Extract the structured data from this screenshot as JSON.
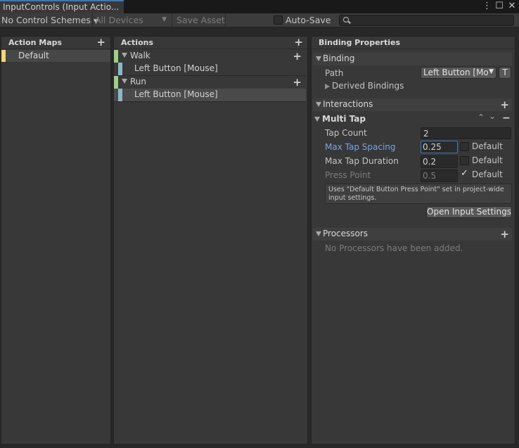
{
  "window": {
    "tab_title": "InputControls (Input Actio...",
    "menu_icon": "vertical-dots-icon",
    "maximize_icon": "maximize-icon",
    "close_icon": "close-icon",
    "menu_glyph": "⋮",
    "maximize_glyph": "☐",
    "close_glyph": "✕"
  },
  "toolbar": {
    "control_schemes": "No Control Schemes",
    "devices": "All Devices",
    "save_asset": "Save Asset",
    "auto_save": "Auto-Save",
    "auto_save_checked": false,
    "search_value": "",
    "dropdown_glyph": "▼"
  },
  "action_maps": {
    "header": "Action Maps",
    "add_glyph": "+",
    "items": [
      {
        "label": "Default",
        "color": "#f3d579",
        "selected": true
      }
    ]
  },
  "actions": {
    "header": "Actions",
    "add_glyph": "+",
    "rows": [
      {
        "kind": "action",
        "label": "Walk",
        "color": "#9fcf86"
      },
      {
        "kind": "binding",
        "label": "Left Button [Mouse]",
        "color": "#8ab8c9"
      },
      {
        "kind": "action",
        "label": "Run",
        "color": "#9fcf86"
      },
      {
        "kind": "binding",
        "label": "Left Button [Mouse]",
        "color": "#8ab8c9",
        "selected": true
      }
    ]
  },
  "binding_properties": {
    "header": "Binding Properties",
    "binding_section": "Binding",
    "path_label": "Path",
    "path_value": "Left Button [Mouse]",
    "path_display": "Left Button [Mo",
    "t_button": "T",
    "derived_bindings": "Derived Bindings",
    "interactions_section": "Interactions",
    "multitap": {
      "title": "Multi Tap",
      "up_glyph": "⌃",
      "down_glyph": "⌄",
      "remove_glyph": "−",
      "tap_count_label": "Tap Count",
      "tap_count_value": "2",
      "max_tap_spacing_label": "Max Tap Spacing",
      "max_tap_spacing_value": "0.25",
      "max_tap_duration_label": "Max Tap Duration",
      "max_tap_duration_value": "0.2",
      "press_point_label": "Press Point",
      "press_point_value": "0.5",
      "default_label": "Default",
      "check_glyph": "✓",
      "help_text": "Uses \"Default Button Press Point\" set in project-wide input settings.",
      "open_settings": "Open Input Settings"
    },
    "processors_section": "Processors",
    "no_processors": "No Processors have been added.",
    "accent_color": "#7ba3e0"
  }
}
